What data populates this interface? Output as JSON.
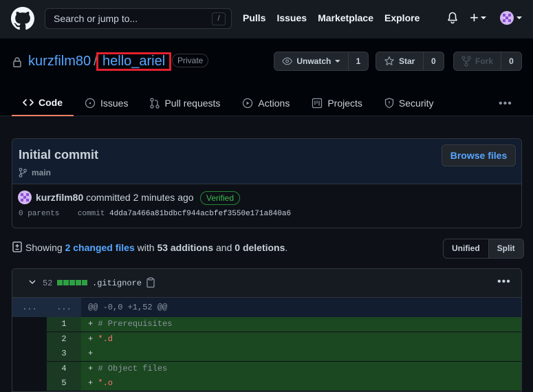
{
  "header": {
    "search_placeholder": "Search or jump to...",
    "search_shortcut": "/",
    "nav": [
      "Pulls",
      "Issues",
      "Marketplace",
      "Explore"
    ],
    "plus_label": "+"
  },
  "repo": {
    "owner": "kurzfilm80",
    "separator": "/",
    "name": "hello_ariel",
    "visibility": "Private",
    "watch_label": "Unwatch",
    "watch_count": "1",
    "star_label": "Star",
    "star_count": "0",
    "fork_label": "Fork",
    "fork_count": "0"
  },
  "tabs": [
    {
      "label": "Code",
      "icon": "code-icon",
      "active": true
    },
    {
      "label": "Issues",
      "icon": "issue-icon"
    },
    {
      "label": "Pull requests",
      "icon": "pull-request-icon"
    },
    {
      "label": "Actions",
      "icon": "play-icon"
    },
    {
      "label": "Projects",
      "icon": "project-icon"
    },
    {
      "label": "Security",
      "icon": "shield-icon"
    }
  ],
  "commit": {
    "title": "Initial commit",
    "branch": "main",
    "browse_label": "Browse files",
    "author": "kurzfilm80",
    "action": " committed 2 minutes ago",
    "verified": "Verified",
    "parents_label": "0 parents",
    "commit_label": "commit",
    "sha": "4dda7a466a81bdbcf944acbfef3550e171a840a6"
  },
  "summary": {
    "showing": "Showing ",
    "changed_files": "2 changed files",
    "with": " with ",
    "additions": "53 additions",
    "and": " and ",
    "deletions": "0 deletions",
    "period": ".",
    "unified_label": "Unified",
    "split_label": "Split"
  },
  "file": {
    "changes": "52",
    "name": ".gitignore",
    "hunk_left": "...",
    "hunk_right": "...",
    "hunk_header": "@@ -0,0 +1,52 @@",
    "lines": [
      {
        "num": "1",
        "text": "# Prerequisites"
      },
      {
        "num": "2",
        "text": "*.d"
      },
      {
        "num": "3",
        "text": ""
      },
      {
        "num": "4",
        "text": "# Object files"
      },
      {
        "num": "5",
        "text": "*.o"
      }
    ]
  },
  "colors": {
    "accent_link": "#58a6ff",
    "added_green": "#2ea043",
    "highlight_box": "#e5202e",
    "tab_underline": "#f78166"
  }
}
